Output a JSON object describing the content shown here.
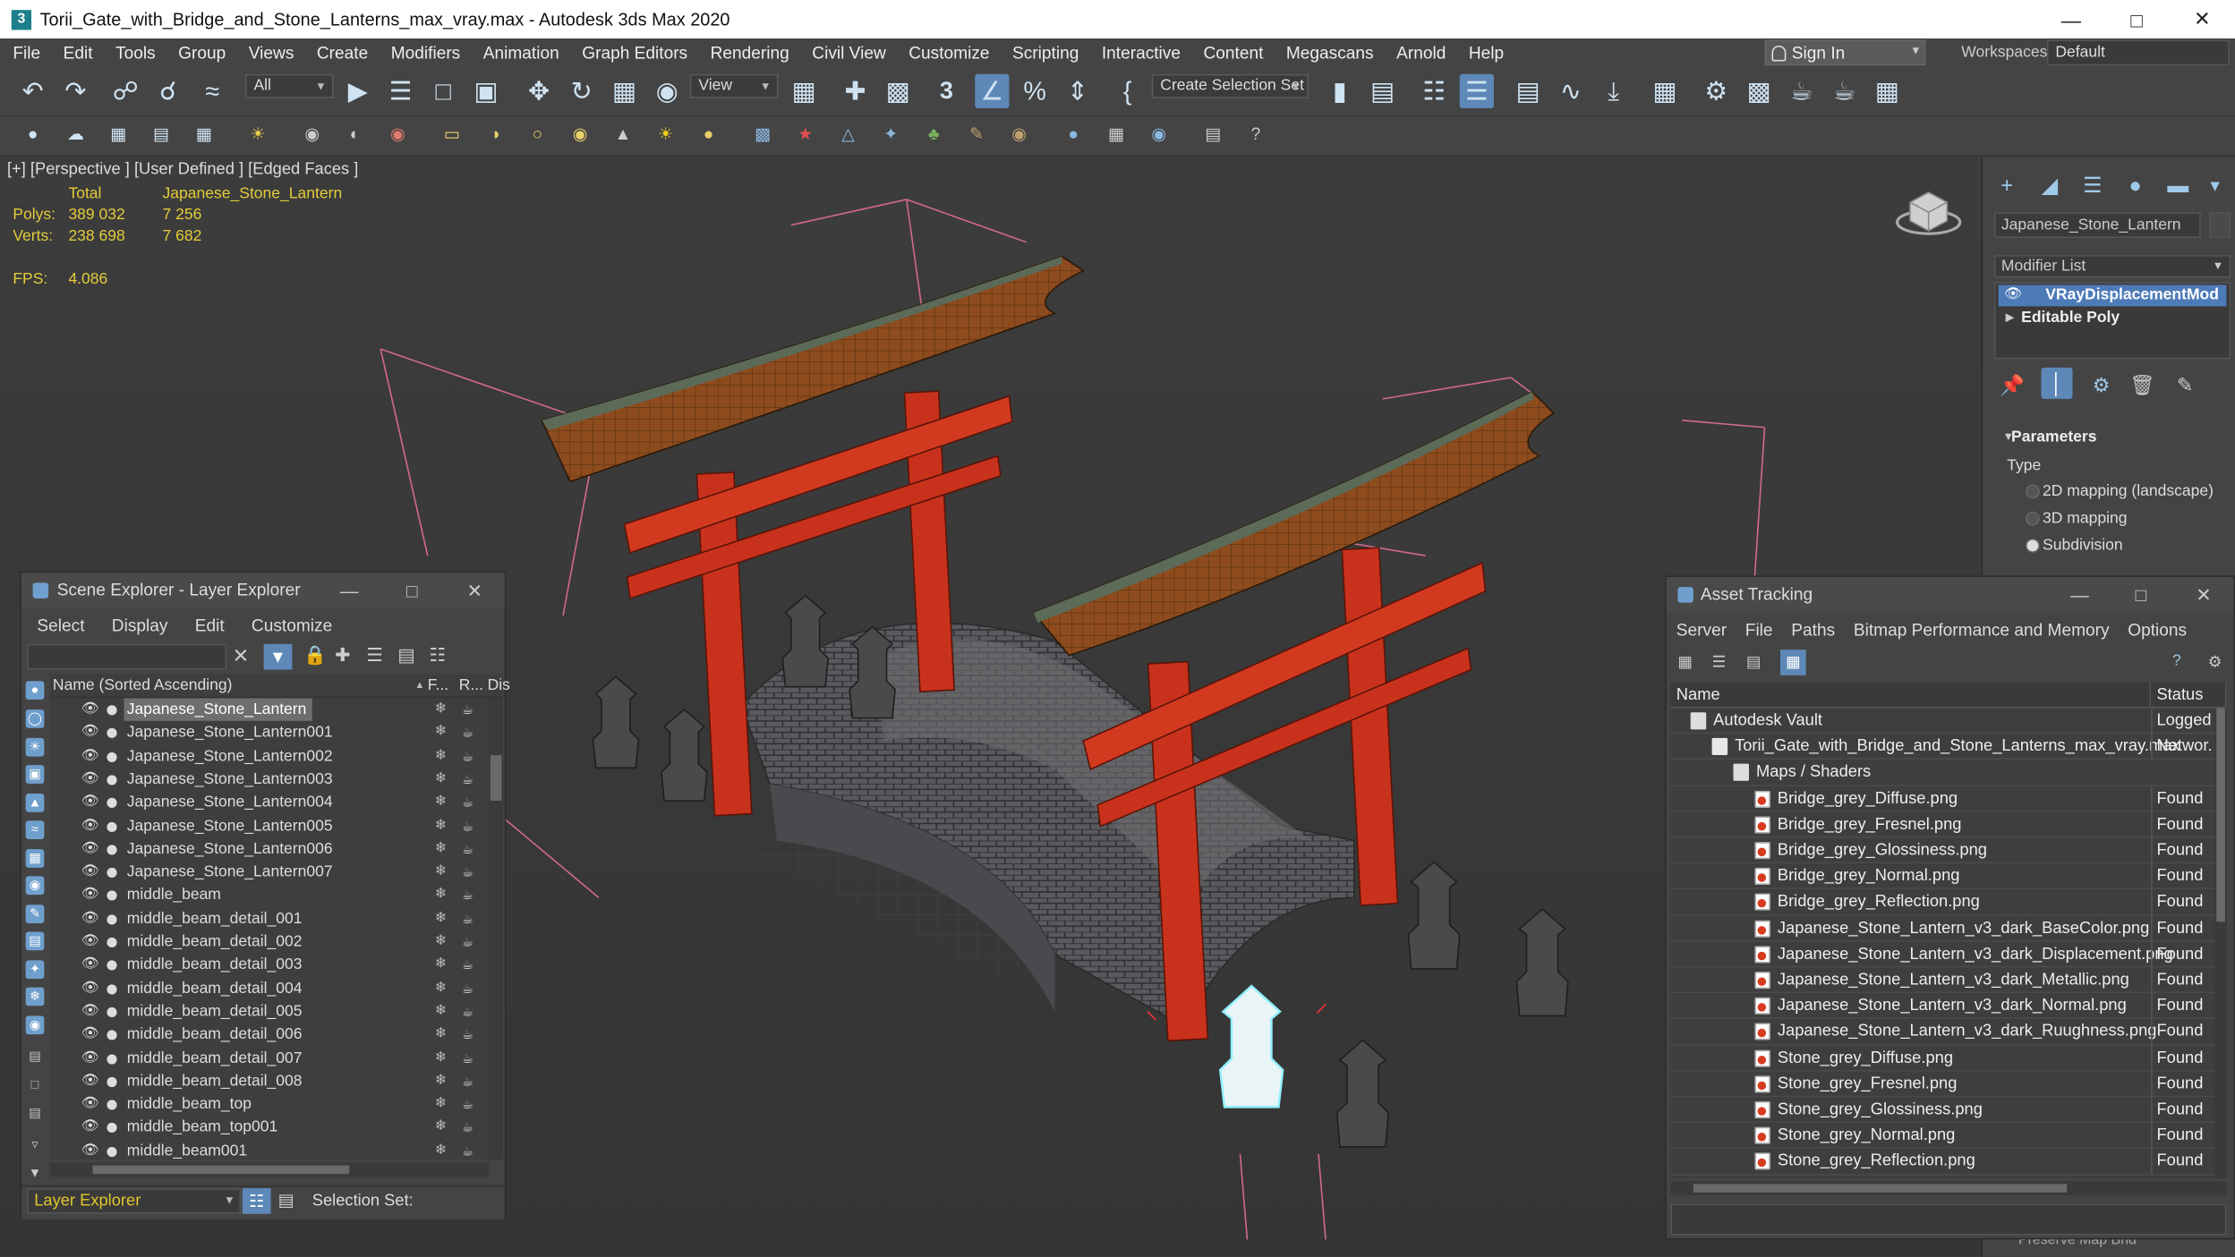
{
  "window": {
    "title": "Torii_Gate_with_Bridge_and_Stone_Lanterns_max_vray.max - Autodesk 3ds Max 2020",
    "logo": "3"
  },
  "menu": [
    "File",
    "Edit",
    "Tools",
    "Group",
    "Views",
    "Create",
    "Modifiers",
    "Animation",
    "Graph Editors",
    "Rendering",
    "Civil View",
    "Customize",
    "Scripting",
    "Interactive",
    "Content",
    "Megascans",
    "Arnold",
    "Help"
  ],
  "account": {
    "sign_in": "Sign In",
    "workspaces_label": "Workspaces:",
    "workspace": "Default"
  },
  "toolbar": {
    "selection_filter": "All",
    "ref_coord": "View",
    "create_selection_set": "Create Selection Set",
    "snap_value": "3"
  },
  "viewport": {
    "label": "[+] [Perspective ] [User Defined ] [Edged Faces ]",
    "stats": {
      "total_label": "Total",
      "object_label": "Japanese_Stone_Lantern",
      "polys_label": "Polys:",
      "polys_total": "389 032",
      "polys_obj": "7 256",
      "verts_label": "Verts:",
      "verts_total": "238 698",
      "verts_obj": "7 682",
      "fps_label": "FPS:",
      "fps": "4.086"
    }
  },
  "command_panel": {
    "object_name": "Japanese_Stone_Lantern",
    "modifier_list": "Modifier List",
    "stack": [
      "VRayDisplacementMod",
      "Editable Poly"
    ],
    "params_title": "Parameters",
    "type_label": "Type",
    "types": [
      "2D mapping (landscape)",
      "3D mapping",
      "Subdivision"
    ],
    "selected_type": 2,
    "bottom_text": "Preserve Map Bnd"
  },
  "scene_explorer": {
    "title": "Scene Explorer - Layer Explorer",
    "menu": [
      "Select",
      "Display",
      "Edit",
      "Customize"
    ],
    "col_name": "Name (Sorted Ascending)",
    "col_f": "F...",
    "col_r": "R...",
    "col_d": "Dis",
    "rows": [
      "Japanese_Stone_Lantern",
      "Japanese_Stone_Lantern001",
      "Japanese_Stone_Lantern002",
      "Japanese_Stone_Lantern003",
      "Japanese_Stone_Lantern004",
      "Japanese_Stone_Lantern005",
      "Japanese_Stone_Lantern006",
      "Japanese_Stone_Lantern007",
      "middle_beam",
      "middle_beam_detail_001",
      "middle_beam_detail_002",
      "middle_beam_detail_003",
      "middle_beam_detail_004",
      "middle_beam_detail_005",
      "middle_beam_detail_006",
      "middle_beam_detail_007",
      "middle_beam_detail_008",
      "middle_beam_top",
      "middle_beam_top001",
      "middle_beam001"
    ],
    "layer": "Layer Explorer",
    "selection_set_label": "Selection Set:"
  },
  "asset_tracking": {
    "title": "Asset Tracking",
    "menu": [
      "Server",
      "File",
      "Paths",
      "Bitmap Performance and Memory",
      "Options"
    ],
    "col_name": "Name",
    "col_status": "Status",
    "rows": [
      {
        "name": "Autodesk Vault",
        "status": "Logged",
        "indent": 0,
        "icon": "vault"
      },
      {
        "name": "Torii_Gate_with_Bridge_and_Stone_Lanterns_max_vray.max",
        "status": "Networ.",
        "indent": 1,
        "icon": "max"
      },
      {
        "name": "Maps / Shaders",
        "status": "",
        "indent": 2,
        "icon": "folder"
      },
      {
        "name": "Bridge_grey_Diffuse.png",
        "status": "Found",
        "indent": 3,
        "icon": "png"
      },
      {
        "name": "Bridge_grey_Fresnel.png",
        "status": "Found",
        "indent": 3,
        "icon": "png"
      },
      {
        "name": "Bridge_grey_Glossiness.png",
        "status": "Found",
        "indent": 3,
        "icon": "png"
      },
      {
        "name": "Bridge_grey_Normal.png",
        "status": "Found",
        "indent": 3,
        "icon": "png"
      },
      {
        "name": "Bridge_grey_Reflection.png",
        "status": "Found",
        "indent": 3,
        "icon": "png"
      },
      {
        "name": "Japanese_Stone_Lantern_v3_dark_BaseColor.png",
        "status": "Found",
        "indent": 3,
        "icon": "png"
      },
      {
        "name": "Japanese_Stone_Lantern_v3_dark_Displacement.png",
        "status": "Found",
        "indent": 3,
        "icon": "png"
      },
      {
        "name": "Japanese_Stone_Lantern_v3_dark_Metallic.png",
        "status": "Found",
        "indent": 3,
        "icon": "png"
      },
      {
        "name": "Japanese_Stone_Lantern_v3_dark_Normal.png",
        "status": "Found",
        "indent": 3,
        "icon": "png"
      },
      {
        "name": "Japanese_Stone_Lantern_v3_dark_Ruughness.png",
        "status": "Found",
        "indent": 3,
        "icon": "png"
      },
      {
        "name": "Stone_grey_Diffuse.png",
        "status": "Found",
        "indent": 3,
        "icon": "png"
      },
      {
        "name": "Stone_grey_Fresnel.png",
        "status": "Found",
        "indent": 3,
        "icon": "png"
      },
      {
        "name": "Stone_grey_Glossiness.png",
        "status": "Found",
        "indent": 3,
        "icon": "png"
      },
      {
        "name": "Stone_grey_Normal.png",
        "status": "Found",
        "indent": 3,
        "icon": "png"
      },
      {
        "name": "Stone_grey_Reflection.png",
        "status": "Found",
        "indent": 3,
        "icon": "png"
      }
    ]
  },
  "colors": {
    "accent": "#4d7bb8",
    "viewport_bg": "#383838",
    "stat_text": "#e3cc3a",
    "gate_red": "#c8321c",
    "roof": "#8a4a1c"
  }
}
